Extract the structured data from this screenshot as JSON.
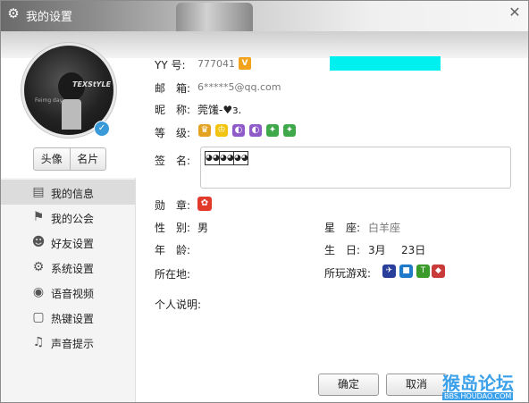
{
  "window": {
    "title": "我的设置",
    "close_icon": "close-icon"
  },
  "profile": {
    "avatar_text": "TEXStYLE",
    "avatar_subtext": "Feimg day",
    "avatar_button": "头像",
    "card_button": "名片"
  },
  "sidebar": {
    "items": [
      {
        "label": "我的信息",
        "icon": "info-card-icon",
        "active": true
      },
      {
        "label": "我的公会",
        "icon": "flag-icon",
        "active": false
      },
      {
        "label": "好友设置",
        "icon": "friend-gear-icon",
        "active": false
      },
      {
        "label": "系统设置",
        "icon": "gear-icon",
        "active": false
      },
      {
        "label": "语音视频",
        "icon": "webcam-icon",
        "active": false
      },
      {
        "label": "热键设置",
        "icon": "keyboard-icon",
        "active": false
      },
      {
        "label": "声音提示",
        "icon": "music-note-icon",
        "active": false
      }
    ]
  },
  "info": {
    "yy_label": "YY 号:",
    "yy_value": "777041",
    "v_badge": "V",
    "email_label": "邮　箱:",
    "email_value": "6*****5@qq.com",
    "nick_label": "昵　称:",
    "nick_value": "莞馐-♥з.",
    "level_label": "等　级:",
    "sign_label": "签　名:",
    "medal_label": "勋　章:",
    "gender_label": "性　别:",
    "gender_value": "男",
    "zodiac_label": "星　座:",
    "zodiac_value": "白羊座",
    "age_label": "年　龄:",
    "birthday_label": "生　日:",
    "birthday_month": "3月",
    "birthday_day": "23日",
    "location_label": "所在地:",
    "games_label": "所玩游戏:",
    "bio_label": "个人说明:"
  },
  "buttons": {
    "ok": "确定",
    "cancel": "取消"
  },
  "watermark": {
    "main": "猴岛论坛",
    "sub": "BBS.HOUDAO.COM"
  },
  "colors": {
    "redact": "#00f0f0",
    "accent": "#3a9ad9",
    "active_bg": "#dcdcdc"
  }
}
